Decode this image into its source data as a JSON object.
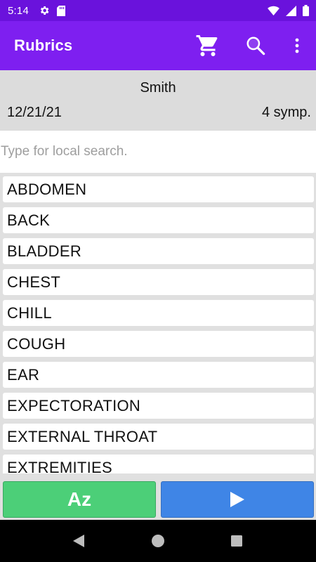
{
  "status_bar": {
    "time": "5:14",
    "icons": [
      "settings-icon",
      "sd-card-icon",
      "wifi-icon",
      "signal-icon",
      "battery-icon"
    ]
  },
  "app_bar": {
    "title": "Rubrics",
    "actions": [
      "cart-icon",
      "search-icon",
      "more-vert-icon"
    ]
  },
  "patient": {
    "name": "Smith",
    "date": "12/21/21",
    "symptoms": "4 symp."
  },
  "search": {
    "placeholder": "Type for local search.",
    "value": ""
  },
  "rubrics": [
    "ABDOMEN",
    "BACK",
    "BLADDER",
    "CHEST",
    "CHILL",
    "COUGH",
    "EAR",
    "EXPECTORATION",
    "EXTERNAL THROAT",
    "EXTREMITIES"
  ],
  "bottom": {
    "sort_label": "Az",
    "play_icon": "play-icon"
  },
  "colors": {
    "status_bar": "#6a12dc",
    "app_bar": "#7e1ff0",
    "sort_button": "#4ccf78",
    "play_button": "#3f85e6"
  }
}
